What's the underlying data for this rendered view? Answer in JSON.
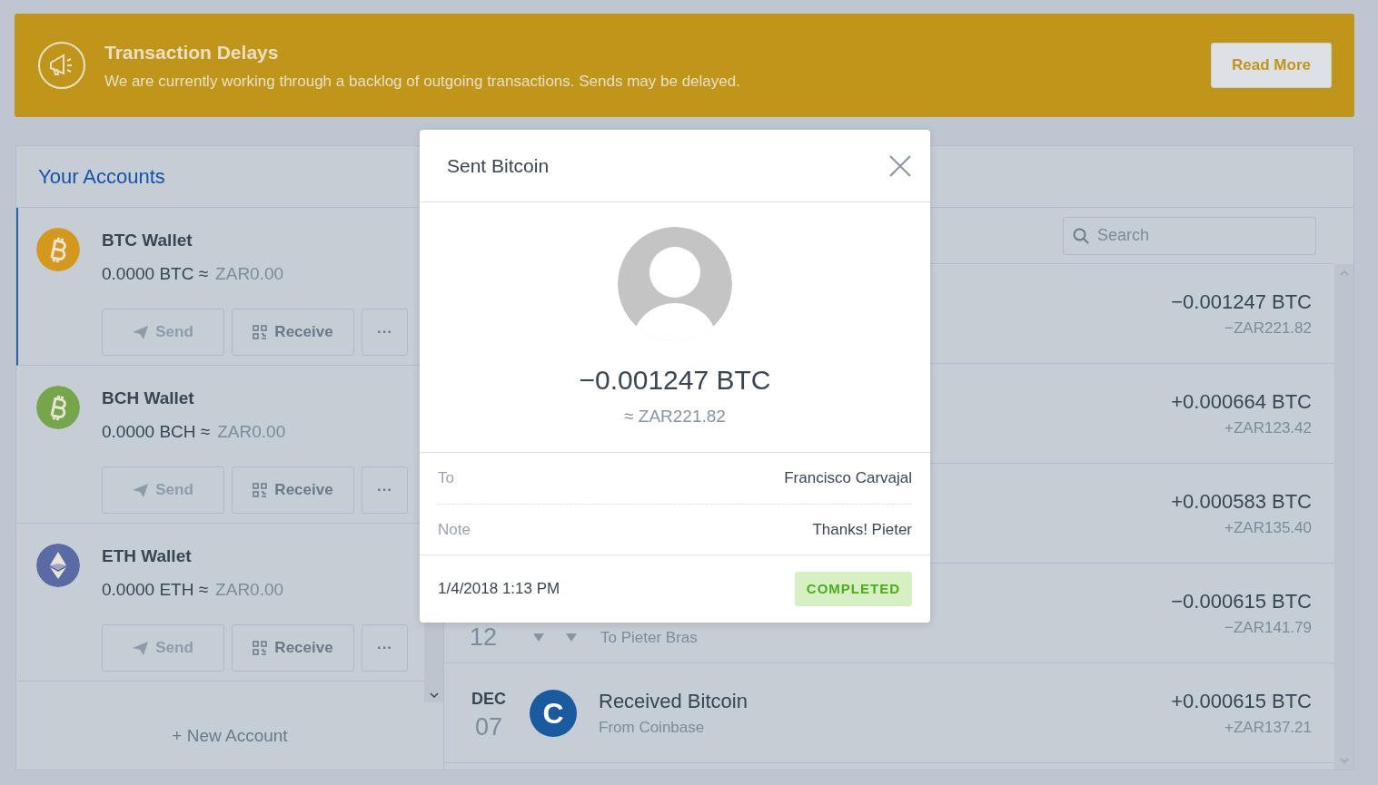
{
  "banner": {
    "title": "Transaction Delays",
    "message": "We are currently working through a backlog of outgoing transactions. Sends may be delayed.",
    "button": "Read More"
  },
  "accounts": {
    "title": "Your Accounts",
    "items": [
      {
        "name": "BTC Wallet",
        "balance": "0.0000 BTC ≈",
        "fiat": "ZAR0.00",
        "kind": "bitcoin",
        "color": "#d4991c",
        "selected": true,
        "send": {
          "label": "Send",
          "disabled": true
        },
        "receive": "Receive",
        "more": "···"
      },
      {
        "name": "BCH Wallet",
        "balance": "0.0000 BCH ≈",
        "fiat": "ZAR0.00",
        "kind": "bitcoin",
        "color": "#76a54a",
        "selected": false,
        "send": {
          "label": "Send",
          "disabled": true
        },
        "receive": "Receive",
        "more": "···"
      },
      {
        "name": "ETH Wallet",
        "balance": "0.0000 ETH ≈",
        "fiat": "ZAR0.00",
        "kind": "ether",
        "color": "#5a6aa5",
        "selected": false,
        "send": {
          "label": "Send",
          "disabled": true
        },
        "receive": "Receive",
        "more": "···"
      }
    ],
    "new_account": "+ New Account"
  },
  "search": {
    "placeholder": "Search"
  },
  "transactions": [
    {
      "kind": "hidden",
      "amount": "−0.001247 BTC",
      "fiat": "−ZAR221.82"
    },
    {
      "kind": "hidden",
      "amount": "+0.000664 BTC",
      "fiat": "+ZAR123.42"
    },
    {
      "kind": "hidden",
      "amount": "+0.000583 BTC",
      "fiat": "+ZAR135.40"
    },
    {
      "kind": "partial",
      "day": "12",
      "subtitle": "To Pieter Bras",
      "amount": "−0.000615 BTC",
      "fiat": "−ZAR141.79"
    },
    {
      "kind": "full",
      "month": "DEC",
      "day": "07",
      "logo": "C",
      "title": "Received Bitcoin",
      "subtitle": "From Coinbase",
      "amount": "+0.000615 BTC",
      "fiat": "+ZAR137.21"
    }
  ],
  "modal": {
    "title": "Sent Bitcoin",
    "amount": "−0.001247 BTC",
    "fiat": "≈ ZAR221.82",
    "details": [
      {
        "label": "To",
        "value": "Francisco Carvajal"
      },
      {
        "label": "Note",
        "value": "Thanks! Pieter"
      }
    ],
    "date": "1/4/2018 1:13 PM",
    "status": "COMPLETED"
  }
}
